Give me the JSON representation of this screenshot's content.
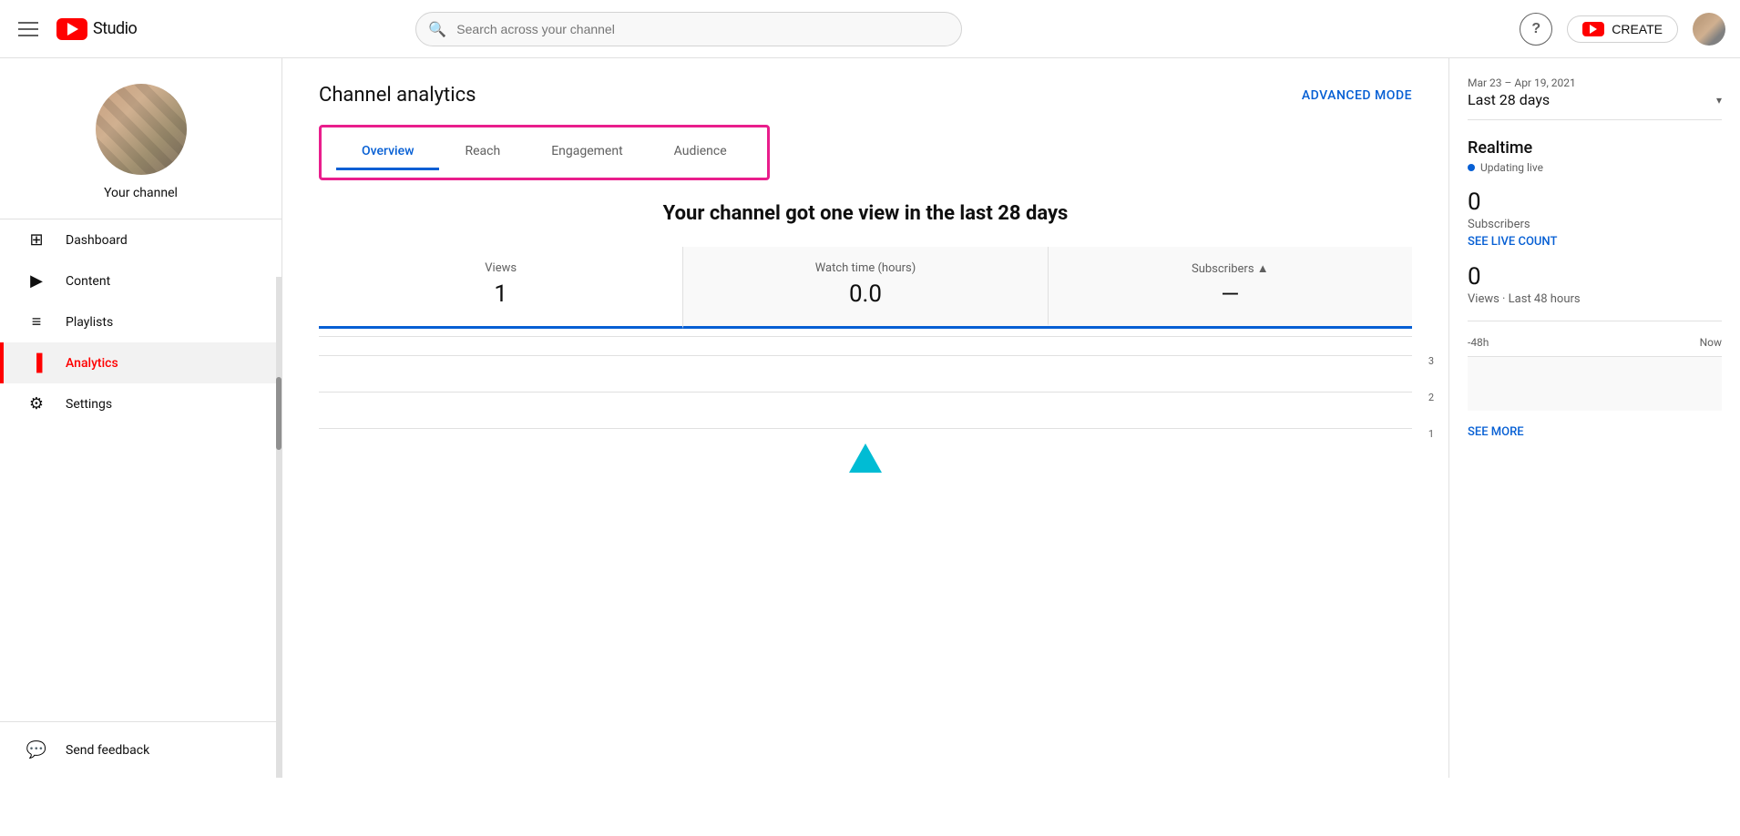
{
  "header": {
    "menu_icon": "hamburger-icon",
    "logo_text": "Studio",
    "search_placeholder": "Search across your channel",
    "help_label": "?",
    "create_label": "CREATE",
    "avatar_alt": "user avatar"
  },
  "sidebar": {
    "channel_name": "Your channel",
    "nav_items": [
      {
        "id": "dashboard",
        "label": "Dashboard",
        "icon": "⊞"
      },
      {
        "id": "content",
        "label": "Content",
        "icon": "▶"
      },
      {
        "id": "playlists",
        "label": "Playlists",
        "icon": "≡"
      },
      {
        "id": "analytics",
        "label": "Analytics",
        "icon": "📊",
        "active": true
      },
      {
        "id": "settings",
        "label": "Settings",
        "icon": "⚙"
      }
    ],
    "bottom_items": [
      {
        "id": "send-feedback",
        "label": "Send feedback",
        "icon": "!"
      }
    ]
  },
  "main": {
    "page_title": "Channel analytics",
    "advanced_mode": "ADVANCED MODE",
    "tabs": [
      {
        "id": "overview",
        "label": "Overview",
        "active": true
      },
      {
        "id": "reach",
        "label": "Reach",
        "active": false
      },
      {
        "id": "engagement",
        "label": "Engagement",
        "active": false
      },
      {
        "id": "audience",
        "label": "Audience",
        "active": false
      }
    ],
    "summary_text": "Your channel got one view in the last 28 days",
    "metrics": [
      {
        "id": "views",
        "label": "Views",
        "value": "1",
        "active": true
      },
      {
        "id": "watchtime",
        "label": "Watch time (hours)",
        "value": "0.0",
        "active": false
      },
      {
        "id": "subscribers",
        "label": "Subscribers",
        "value": "—",
        "has_warning": true,
        "active": false
      }
    ],
    "chart": {
      "y_labels": [
        "3",
        "2",
        "1"
      ]
    }
  },
  "right_panel": {
    "date_range_note": "Mar 23 – Apr 19, 2021",
    "date_range": "Last 28 days",
    "realtime_title": "Realtime",
    "updating_live": "Updating live",
    "subscribers_count": "0",
    "subscribers_label": "Subscribers",
    "see_live_count": "SEE LIVE COUNT",
    "views_count": "0",
    "views_label": "Views · Last 48 hours",
    "time_start": "-48h",
    "time_end": "Now",
    "see_more": "SEE MORE"
  }
}
